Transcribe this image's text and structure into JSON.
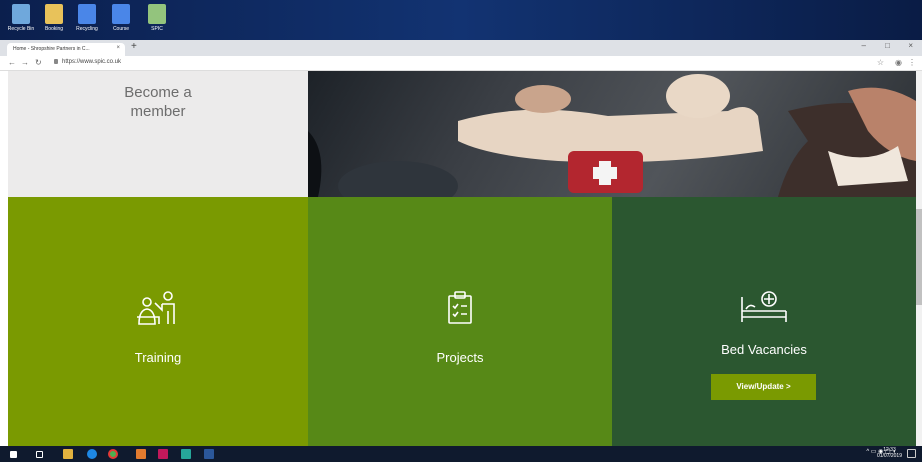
{
  "desktop": {
    "icons": [
      {
        "label": "Recycle Bin",
        "color": "#6fa8dc"
      },
      {
        "label": "Booking",
        "color": "#e8c25a"
      },
      {
        "label": "Recycling",
        "color": "#4a86e8"
      },
      {
        "label": "Course",
        "color": "#4a86e8"
      },
      {
        "label": "SPIC",
        "color": "#93c47d"
      }
    ]
  },
  "browser": {
    "tab_title": "Home - Shropshire Partners in C...",
    "tab_close": "×",
    "new_tab": "+",
    "url": "https://www.spic.co.uk",
    "win_min": "–",
    "win_max": "□",
    "win_close": "×"
  },
  "page": {
    "member_text": "Become a member",
    "panels": [
      {
        "label": "Training",
        "color": "#7a9a01",
        "icon": "trainer-icon"
      },
      {
        "label": "Projects",
        "color": "#578917",
        "icon": "clipboard-icon"
      },
      {
        "label": "Bed Vacancies",
        "color": "#2b5730",
        "icon": "bed-icon"
      }
    ],
    "bed_button": "View/Update  >"
  },
  "taskbar": {
    "time": "12:33",
    "date": "01/07/2019"
  }
}
